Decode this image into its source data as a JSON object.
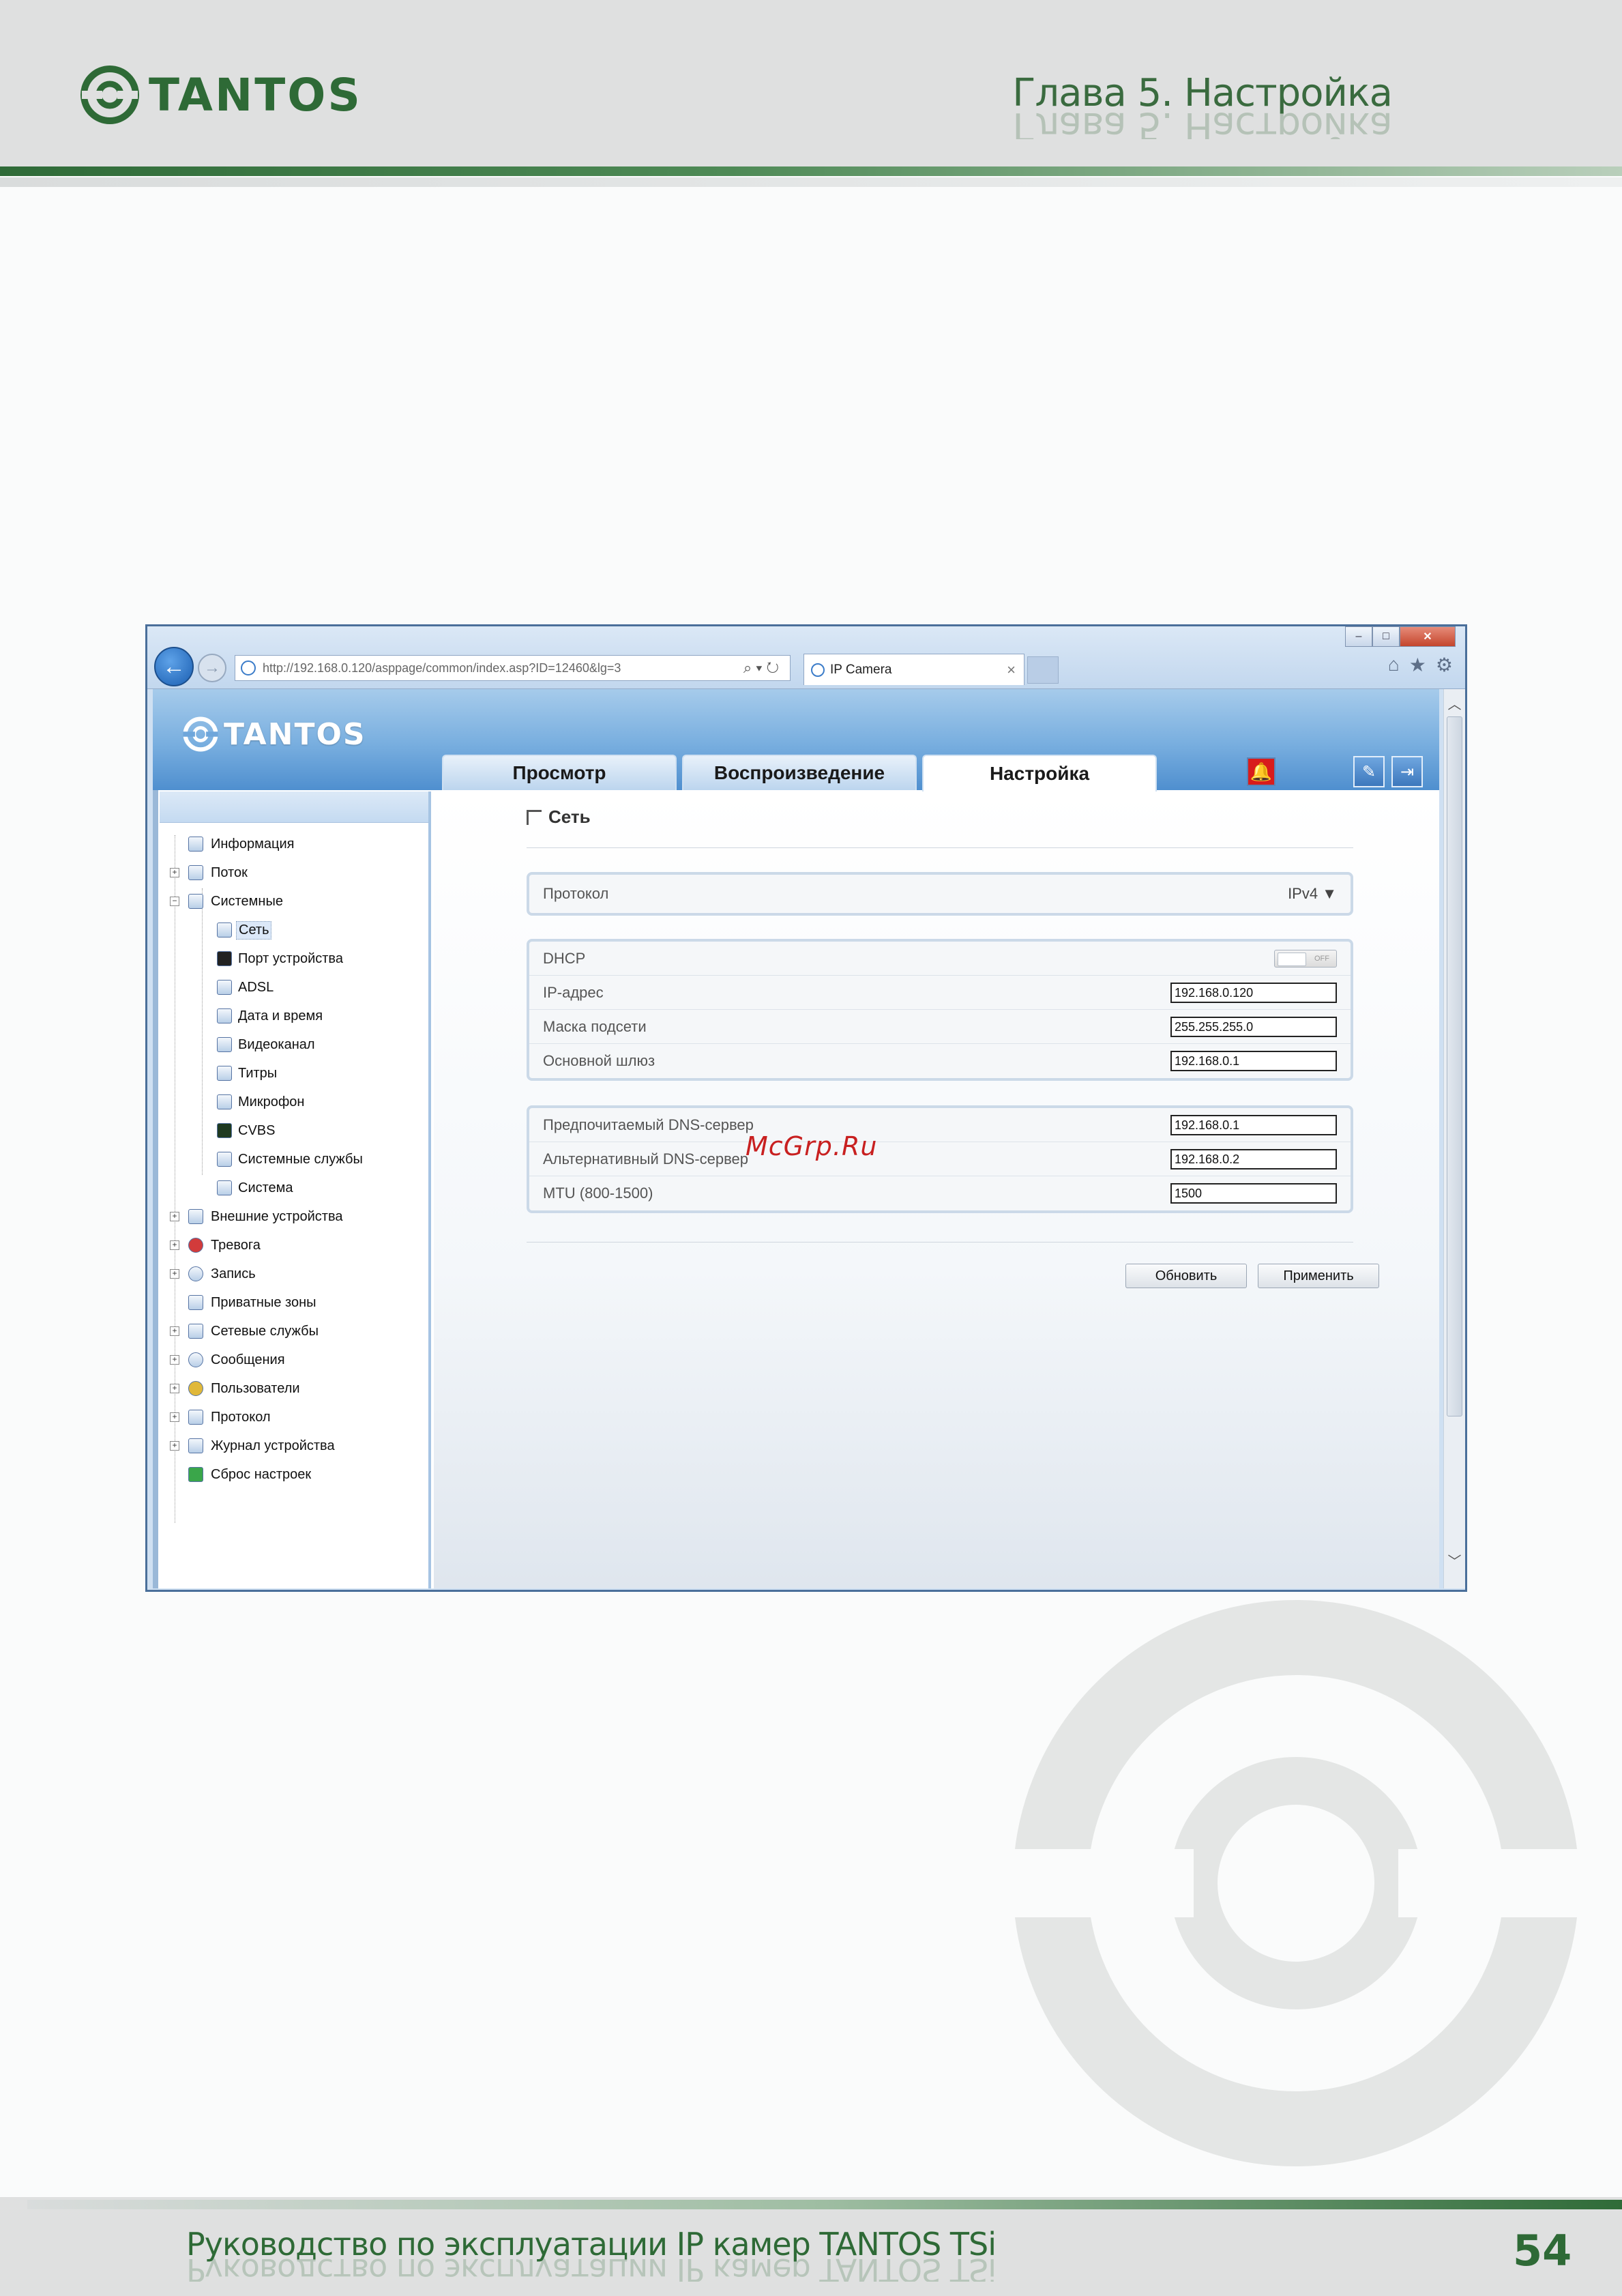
{
  "header": {
    "logo_text": "TANTOS",
    "chapter_title": "Глава 5. Настройка"
  },
  "footer": {
    "title": "Руководство по эксплуатации IP камер TANTOS TSi",
    "page_number": "54"
  },
  "colors": {
    "brand_green": "#2e6a36",
    "window_blue": "#4f8fcf",
    "alarm_red": "#d81c1c",
    "watermark_red": "#c82020"
  },
  "browser": {
    "address_url": "http://192.168.0.120/asppage/common/index.asp?ID=12460&lg=3",
    "tab_title": "IP Camera",
    "tab_close": "×"
  },
  "app": {
    "logo_text": "TANTOS",
    "tabs": [
      {
        "label": "Просмотр"
      },
      {
        "label": "Воспроизведение"
      },
      {
        "label": "Настройка"
      }
    ],
    "active_tab": "Настройка"
  },
  "sidebar": {
    "items": [
      {
        "label": "Информация"
      },
      {
        "label": "Поток"
      },
      {
        "label": "Системные"
      },
      {
        "label": "Сеть"
      },
      {
        "label": "Порт устройства"
      },
      {
        "label": "ADSL"
      },
      {
        "label": "Дата и время"
      },
      {
        "label": "Видеоканал"
      },
      {
        "label": "Титры"
      },
      {
        "label": "Микрофон"
      },
      {
        "label": "CVBS"
      },
      {
        "label": "Системные службы"
      },
      {
        "label": "Система"
      },
      {
        "label": "Внешние устройства"
      },
      {
        "label": "Тревога"
      },
      {
        "label": "Запись"
      },
      {
        "label": "Приватные зоны"
      },
      {
        "label": "Сетевые службы"
      },
      {
        "label": "Сообщения"
      },
      {
        "label": "Пользователи"
      },
      {
        "label": "Протокол"
      },
      {
        "label": "Журнал устройства"
      },
      {
        "label": "Сброс настроек"
      }
    ]
  },
  "network": {
    "title": "Сеть",
    "protocol_label": "Протокол",
    "protocol_value": "IPv4",
    "dhcp_label": "DHCP",
    "dhcp_state": "OFF",
    "ip_label": "IP-адрес",
    "ip_value": "192.168.0.120",
    "mask_label": "Маска подсети",
    "mask_value": "255.255.255.0",
    "gateway_label": "Основной шлюз",
    "gateway_value": "192.168.0.1",
    "dns1_label": "Предпочитаемый DNS-сервер",
    "dns1_value": "192.168.0.1",
    "dns2_label": "Альтернативный DNS-сервер",
    "dns2_value": "192.168.0.2",
    "mtu_label": "MTU (800-1500)",
    "mtu_value": "1500",
    "refresh_label": "Обновить",
    "apply_label": "Применить"
  },
  "overlay": {
    "watermark_text": "McGrp.Ru"
  }
}
